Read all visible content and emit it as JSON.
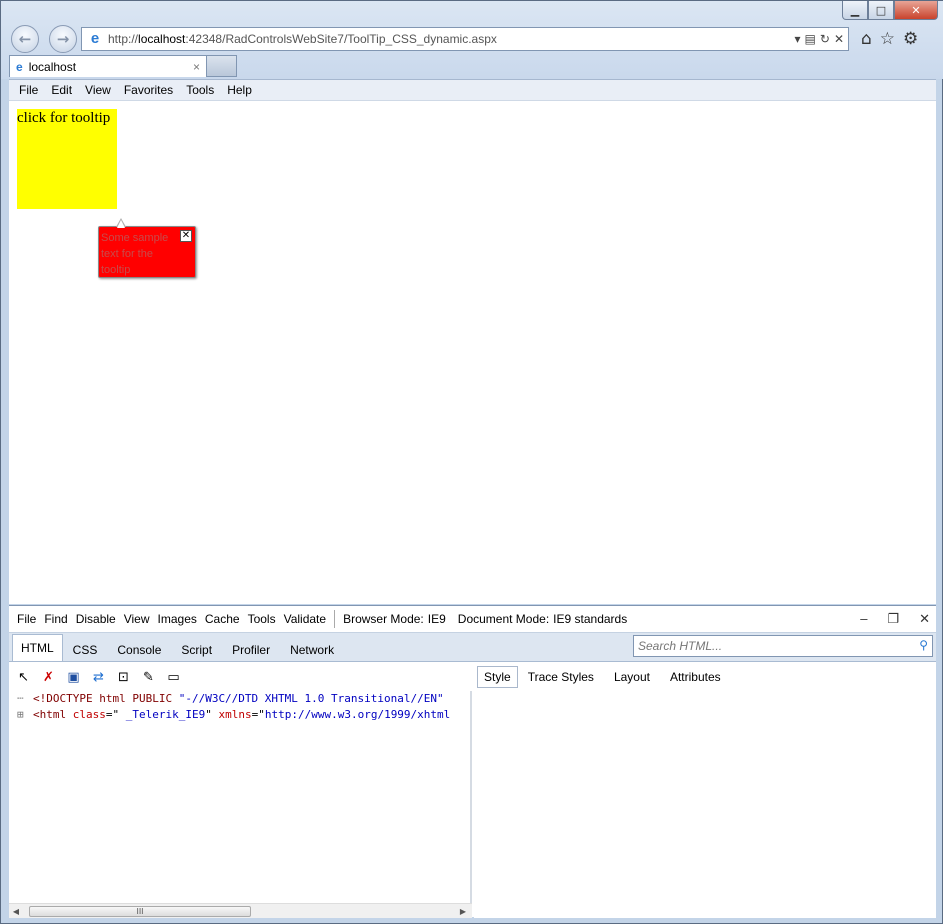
{
  "browser": {
    "address_url_prefix": "http://",
    "address_url_host": "localhost",
    "address_url_rest": ":42348/RadControlsWebSite7/ToolTip_CSS_dynamic.aspx",
    "tab_title": "localhost",
    "tab_close": "×"
  },
  "window_controls": {
    "minimize": "▁",
    "maximize": "□",
    "close": "✕"
  },
  "menu": {
    "file": "File",
    "edit": "Edit",
    "view": "View",
    "favorites": "Favorites",
    "tools": "Tools",
    "help": "Help"
  },
  "page": {
    "yellow_box_text": "click for tooltip",
    "tooltip_text": "Some sample text for the tooltip",
    "tooltip_close": "✕",
    "yellow_color": "#ffff00",
    "tooltip_color": "#ff0000"
  },
  "devtools": {
    "menu": {
      "file": "File",
      "find": "Find",
      "disable": "Disable",
      "view": "View",
      "images": "Images",
      "cache": "Cache",
      "tools": "Tools",
      "validate": "Validate",
      "browser_mode_label": "Browser Mode:",
      "browser_mode_value": "IE9",
      "document_mode_label": "Document Mode:",
      "document_mode_value": "IE9 standards"
    },
    "tabs": [
      "HTML",
      "CSS",
      "Console",
      "Script",
      "Profiler",
      "Network"
    ],
    "search_placeholder": "Search HTML...",
    "subtabs": [
      "Style",
      "Trace Styles",
      "Layout",
      "Attributes"
    ],
    "code_lines": [
      {
        "prefix": "",
        "parts": [
          {
            "t": "<!DOCTYPE html PUBLIC ",
            "c": "c-dark"
          },
          {
            "t": "\"-//W3C//DTD XHTML 1.0 Transitional//EN\"",
            "c": "c-blue"
          }
        ]
      },
      {
        "prefix": "⊞",
        "parts": [
          {
            "t": "<html ",
            "c": "c-dark"
          },
          {
            "t": "class",
            "c": "c-red"
          },
          {
            "t": "=\" ",
            "c": "c-black"
          },
          {
            "t": "_Telerik_IE9",
            "c": "c-blue"
          },
          {
            "t": "\" ",
            "c": "c-black"
          },
          {
            "t": "xmlns",
            "c": "c-red"
          },
          {
            "t": "=\"",
            "c": "c-black"
          },
          {
            "t": "http://www.w3.org/1999/xhtml",
            "c": "c-blue"
          }
        ]
      }
    ],
    "scroll_thumb": "III"
  }
}
